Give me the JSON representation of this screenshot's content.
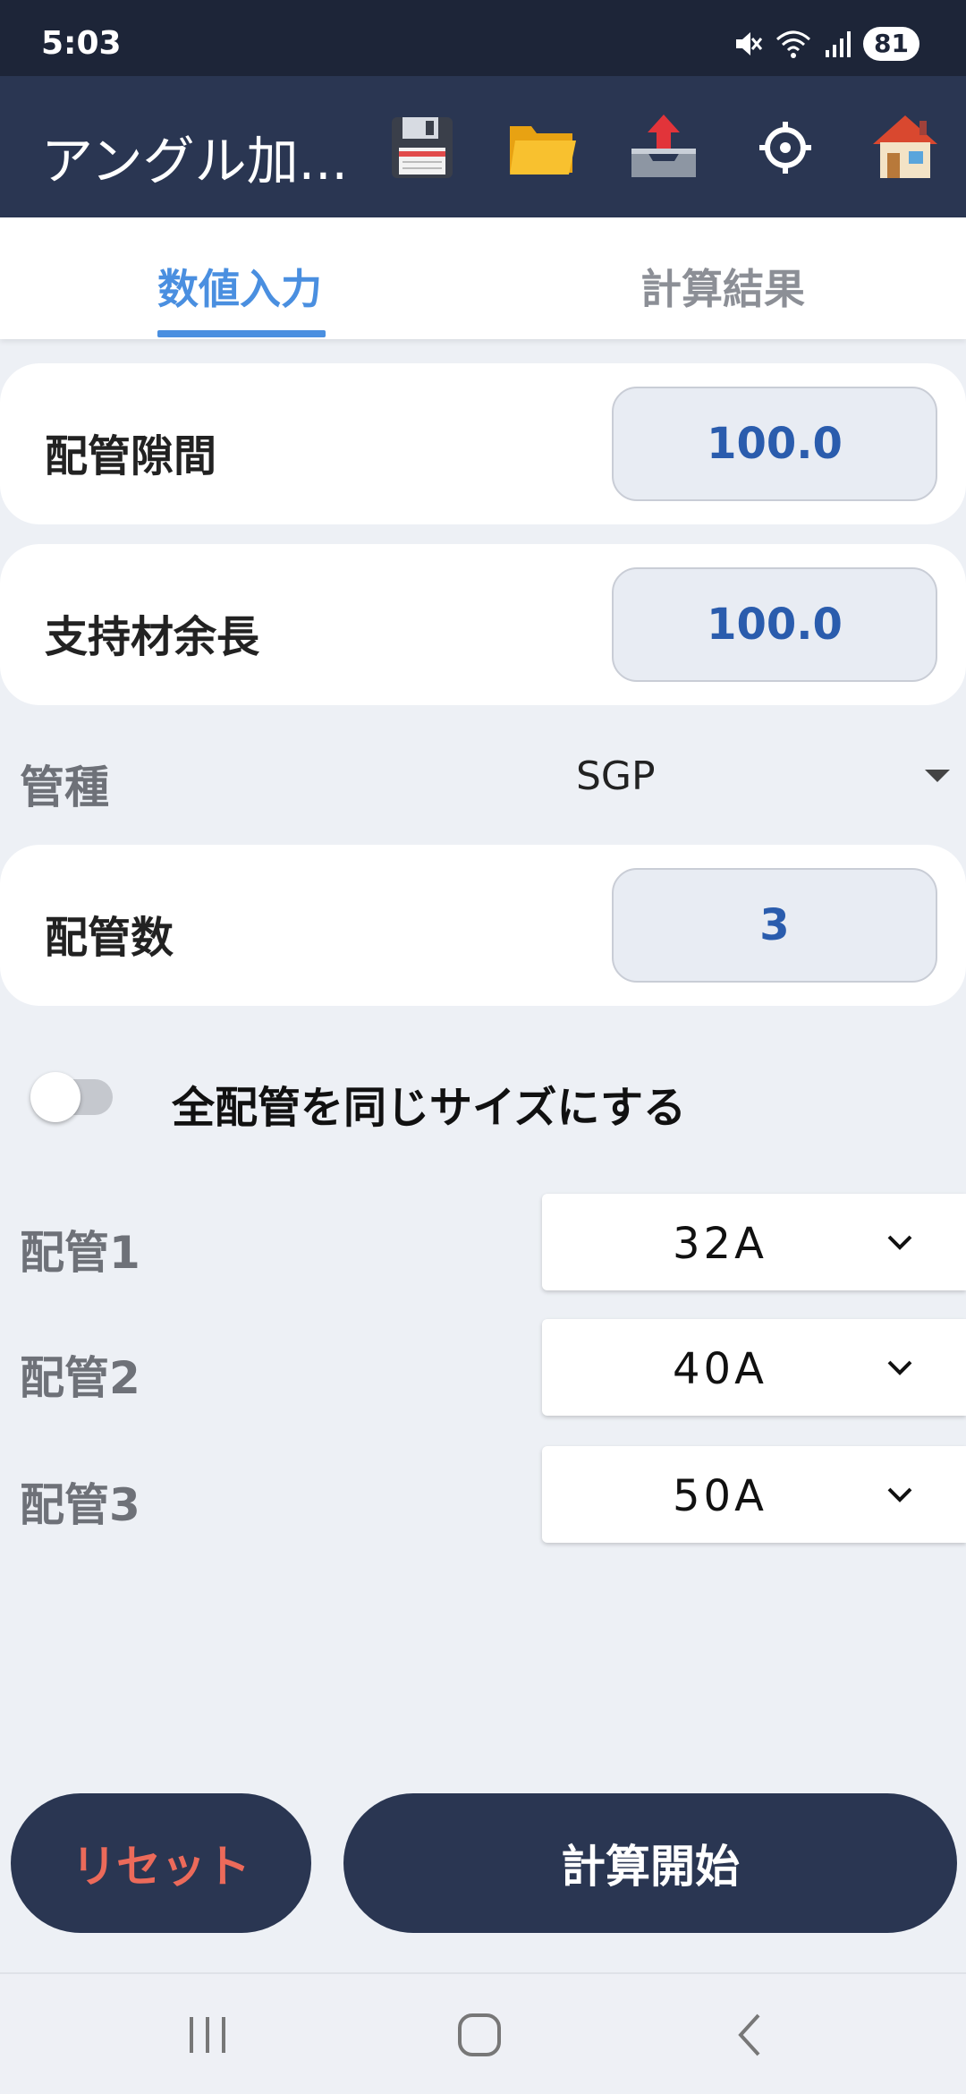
{
  "status_bar": {
    "time": "5:03",
    "battery": "81"
  },
  "app_bar": {
    "title": "アングル加...",
    "icons": [
      "save-icon",
      "folder-icon",
      "export-icon",
      "settings-icon",
      "home-icon"
    ]
  },
  "tabs": [
    {
      "label": "数値入力",
      "active": true
    },
    {
      "label": "計算結果",
      "active": false
    }
  ],
  "fields": {
    "pipe_gap": {
      "label": "配管隙間",
      "value": "100.0"
    },
    "support_extra": {
      "label": "支持材余長",
      "value": "100.0"
    },
    "pipe_count": {
      "label": "配管数",
      "value": "3"
    }
  },
  "pipe_type": {
    "label": "管種",
    "value": "SGP"
  },
  "same_size_toggle": {
    "label": "全配管を同じサイズにする",
    "on": false
  },
  "pipes": [
    {
      "label": "配管1",
      "size": "32A"
    },
    {
      "label": "配管2",
      "size": "40A"
    },
    {
      "label": "配管3",
      "size": "50A"
    }
  ],
  "buttons": {
    "reset": "リセット",
    "calculate": "計算開始"
  },
  "colors": {
    "app_bar": "#2a3652",
    "accent": "#4a8fe0",
    "reset_text": "#ec6a5a",
    "value_text": "#2a5cad"
  }
}
